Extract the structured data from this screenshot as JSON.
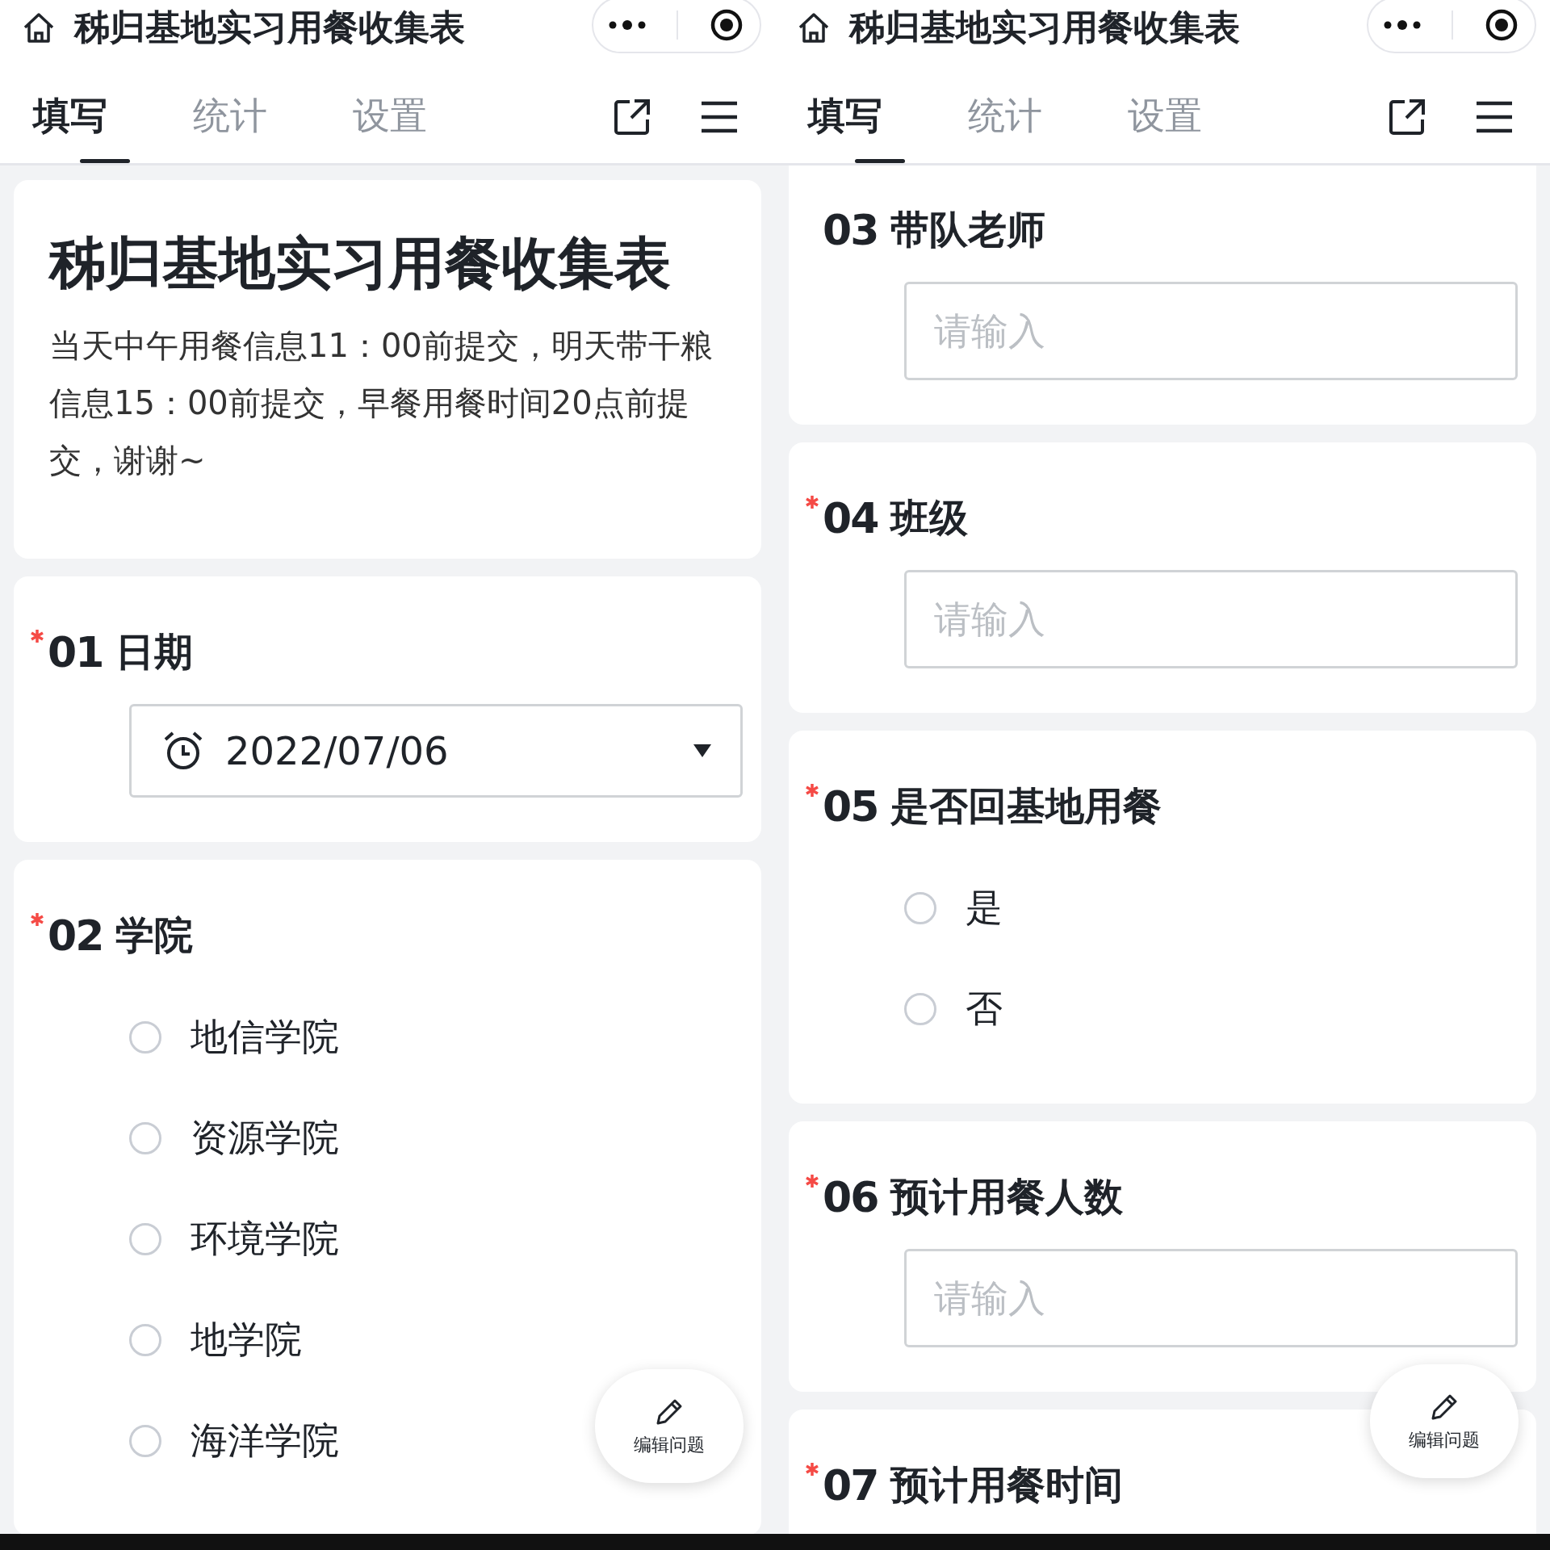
{
  "screens": [
    {
      "header": {
        "title": "秭归基地实习用餐收集表"
      },
      "tabs": [
        {
          "label": "填写",
          "selected": true
        },
        {
          "label": "统计",
          "selected": false
        },
        {
          "label": "设置",
          "selected": false
        }
      ],
      "form": {
        "title": "秭归基地实习用餐收集表",
        "description": "当天中午用餐信息11：00前提交，明天带干粮信息15：00前提交，早餐用餐时间20点前提交，谢谢~"
      },
      "questions": [
        {
          "number": "01",
          "title": "日期",
          "required": true,
          "kind": "date",
          "value": "2022/07/06"
        },
        {
          "number": "02",
          "title": "学院",
          "required": true,
          "kind": "radio",
          "options": [
            {
              "label": "地信学院",
              "selected": false
            },
            {
              "label": "资源学院",
              "selected": false
            },
            {
              "label": "环境学院",
              "selected": false
            },
            {
              "label": "地学院",
              "selected": false
            },
            {
              "label": "海洋学院",
              "selected": false
            }
          ]
        }
      ],
      "fab": {
        "label": "编辑问题"
      }
    },
    {
      "header": {
        "title": "秭归基地实习用餐收集表"
      },
      "tabs": [
        {
          "label": "填写",
          "selected": true
        },
        {
          "label": "统计",
          "selected": false
        },
        {
          "label": "设置",
          "selected": false
        }
      ],
      "questions": [
        {
          "number": "03",
          "title": "带队老师",
          "required": false,
          "kind": "text",
          "placeholder": "请输入"
        },
        {
          "number": "04",
          "title": "班级",
          "required": true,
          "kind": "text",
          "placeholder": "请输入"
        },
        {
          "number": "05",
          "title": "是否回基地用餐",
          "required": true,
          "kind": "radio",
          "options": [
            {
              "label": "是",
              "selected": false
            },
            {
              "label": "否",
              "selected": false
            }
          ]
        },
        {
          "number": "06",
          "title": "预计用餐人数",
          "required": true,
          "kind": "text",
          "placeholder": "请输入"
        },
        {
          "number": "07",
          "title": "预计用餐时间",
          "required": true,
          "kind": "label"
        }
      ],
      "fab": {
        "label": "编辑问题"
      }
    }
  ]
}
